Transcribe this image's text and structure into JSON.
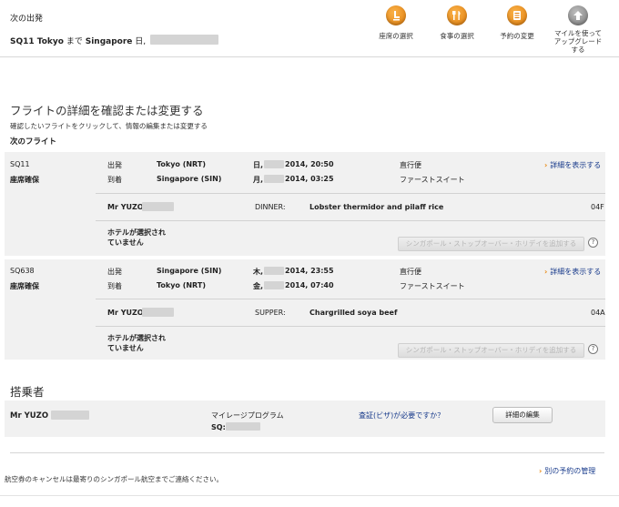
{
  "header": {
    "section_label": "次の出発",
    "route_bold": "SQ11 Tokyo",
    "route_made": "まで",
    "route_dest_bold": "Singapore",
    "route_day": "日,",
    "actions": [
      {
        "label_lines": [
          "座席の選択"
        ],
        "icon": "seat-icon"
      },
      {
        "label_lines": [
          "食事の選択"
        ],
        "icon": "meal-icon"
      },
      {
        "label_lines": [
          "予約の変更"
        ],
        "icon": "booking-icon"
      },
      {
        "label_lines": [
          "マイルを使って",
          "アップグレード",
          "する"
        ],
        "icon": "upgrade-arrow-icon"
      }
    ]
  },
  "main": {
    "title": "フライトの詳細を確認または変更する",
    "subtitle": "確認したいフライトをクリックして、情報の編集または変更する",
    "next_flight_label": "次のフライト"
  },
  "flights": [
    {
      "number": "SQ11",
      "status": "座席確保",
      "dep_label": "出発",
      "arr_label": "到着",
      "dep_city": "Tokyo (NRT)",
      "arr_city": "Singapore (SIN)",
      "dep_day": "日,",
      "dep_time": "2014, 20:50",
      "arr_day": "月,",
      "arr_time": "2014, 03:25",
      "flight_type": "直行便",
      "cabin": "ファーストスイート",
      "details_link": "詳細を表示する",
      "passenger": "Mr YUZO",
      "meal_type": "DINNER:",
      "meal": "Lobster thermidor and pilaff rice",
      "seat": "04F",
      "hotel_line1": "ホテルが選択され",
      "hotel_line2": "ていません",
      "stopover_button": "シンガポール・ストップオーバー・ホリデイを追加する"
    },
    {
      "number": "SQ638",
      "status": "座席確保",
      "dep_label": "出発",
      "arr_label": "到着",
      "dep_city": "Singapore (SIN)",
      "arr_city": "Tokyo (NRT)",
      "dep_day": "木,",
      "dep_time": "2014, 23:55",
      "arr_day": "金,",
      "arr_time": "2014, 07:40",
      "flight_type": "直行便",
      "cabin": "ファーストスイート",
      "details_link": "詳細を表示する",
      "passenger": "Mr YUZO",
      "meal_type": "SUPPER:",
      "meal": "Chargrilled soya beef",
      "seat": "04A",
      "hotel_line1": "ホテルが選択され",
      "hotel_line2": "ていません",
      "stopover_button": "シンガポール・ストップオーバー・ホリデイを追加する"
    }
  ],
  "passengers": {
    "title": "搭乗者",
    "name": "Mr YUZO",
    "mileage_label": "マイレージプログラム",
    "sq_label": "SQ:",
    "visa_question": "査証(ビザ)が必要ですか？",
    "edit_button": "詳細の編集"
  },
  "footer": {
    "manage_link": "別の予約の管理",
    "notice": "航空券のキャンセルは最寄りのシンガポール航空までご連絡ください。"
  },
  "colors": {
    "accent_orange": "#e8860c",
    "panel_bg": "#f1f1f1",
    "link_blue": "#1a3c8c"
  }
}
